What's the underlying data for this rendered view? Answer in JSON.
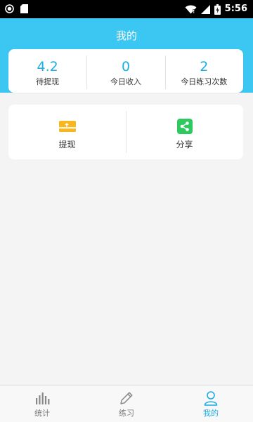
{
  "status_bar": {
    "time": "5:56",
    "left_icons": [
      "circle-icon",
      "sd-card-icon"
    ],
    "right_icons": [
      "wifi-icon",
      "signal-icon",
      "battery-icon"
    ]
  },
  "header": {
    "title": "我的"
  },
  "stats": [
    {
      "value": "4.2",
      "label": "待提现"
    },
    {
      "value": "0",
      "label": "今日收入"
    },
    {
      "value": "2",
      "label": "今日练习次数"
    }
  ],
  "actions": [
    {
      "label": "提现",
      "icon": "withdraw-card-icon",
      "color": "#f7b720"
    },
    {
      "label": "分享",
      "icon": "share-icon",
      "color": "#2dc95e"
    }
  ],
  "tabs": [
    {
      "label": "统计",
      "icon": "bar-chart-icon",
      "active": false
    },
    {
      "label": "练习",
      "icon": "pencil-icon",
      "active": false
    },
    {
      "label": "我的",
      "icon": "user-icon",
      "active": true
    }
  ],
  "colors": {
    "accent": "#3cc6f2",
    "value_blue": "#19aee5"
  }
}
